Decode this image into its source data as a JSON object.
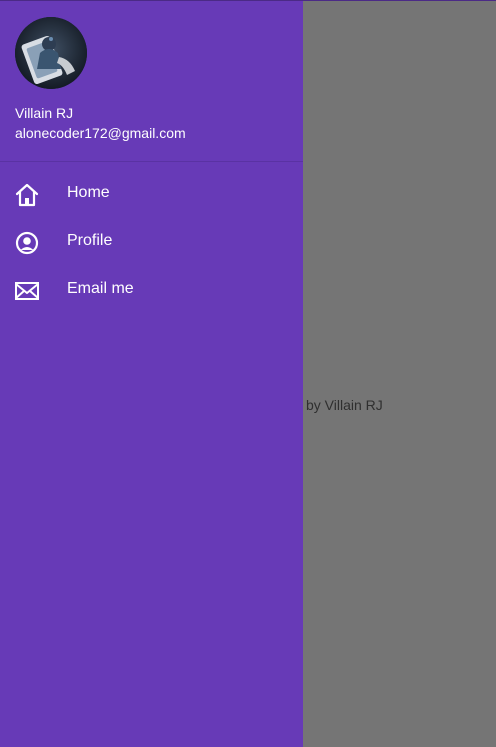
{
  "drawer": {
    "header": {
      "name": "Villain RJ",
      "email": "alonecoder172@gmail.com",
      "avatar_icon": "profile-photo"
    },
    "items": [
      {
        "label": "Home",
        "icon": "home-icon"
      },
      {
        "label": "Profile",
        "icon": "account-circle-icon"
      },
      {
        "label": "Email me",
        "icon": "mail-icon"
      }
    ],
    "accent_color": "#673ab7"
  },
  "background": {
    "footer_text": "by Villain RJ",
    "scrim_color": "#757575"
  }
}
